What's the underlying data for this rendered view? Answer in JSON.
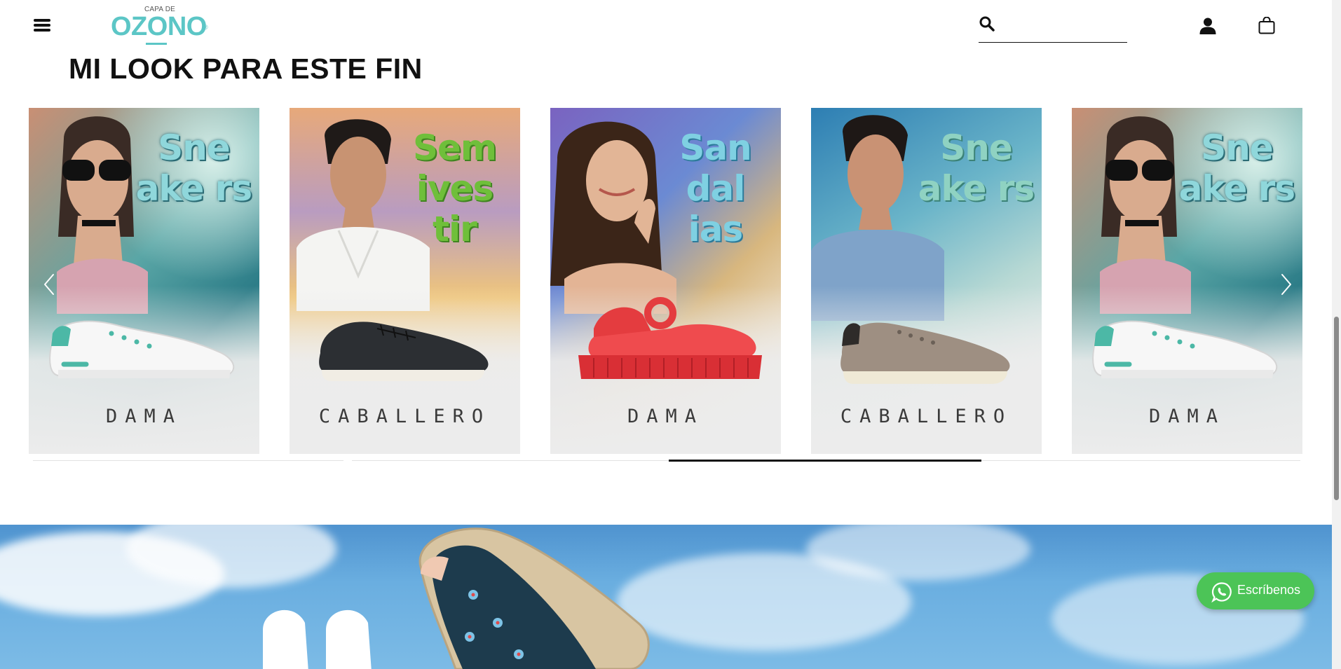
{
  "header": {
    "menu_icon": "hamburger-menu-icon",
    "logo_small": "CAPA DE",
    "logo_big": "OZONO",
    "logo_reg": "®",
    "search": {
      "icon": "search-icon",
      "placeholder": "",
      "value": ""
    },
    "user_icon": "user-icon",
    "cart_icon": "shopping-bag-icon"
  },
  "section": {
    "title": "MI LOOK PARA ESTE FIN"
  },
  "carousel": {
    "prev_icon": "chevron-left-icon",
    "next_icon": "chevron-right-icon",
    "progress": 0.25,
    "cards": [
      {
        "label": "DAMA",
        "bubble_text": "Sne ake rs",
        "bubble_color": "#7fd3d8",
        "product": "white-sneaker"
      },
      {
        "label": "CABALLERO",
        "bubble_text": "Sem ives tir",
        "bubble_color": "#6fbf3a",
        "product": "black-derby-shoe"
      },
      {
        "label": "DAMA",
        "bubble_text": "San dal ias",
        "bubble_color": "#79cde0",
        "product": "red-sandal"
      },
      {
        "label": "CABALLERO",
        "bubble_text": "Sne ake rs",
        "bubble_color": "#8fd2c2",
        "product": "taupe-sneaker"
      },
      {
        "label": "DAMA",
        "bubble_text": "Sne ake rs",
        "bubble_color": "#7fd3d8",
        "product": "white-sneaker"
      }
    ]
  },
  "whatsapp": {
    "label": "Escríbenos",
    "icon": "whatsapp-icon",
    "color": "#4cc457"
  },
  "colors": {
    "brand": "#5cc6c6",
    "text": "#111111"
  }
}
